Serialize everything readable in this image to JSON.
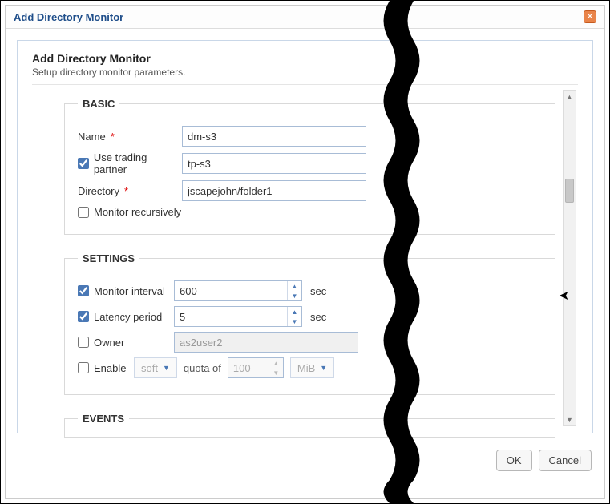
{
  "dialog": {
    "title": "Add Directory Monitor",
    "panel_title": "Add Directory Monitor",
    "panel_subtitle": "Setup directory monitor parameters."
  },
  "basic": {
    "legend": "BASIC",
    "name_label": "Name",
    "name_value": "dm-s3",
    "use_tp_label": "Use trading partner",
    "use_tp_checked": true,
    "tp_value": "tp-s3",
    "directory_label": "Directory",
    "directory_value": "jscapejohn/folder1",
    "recursive_label": "Monitor recursively",
    "recursive_checked": false
  },
  "settings": {
    "legend": "SETTINGS",
    "interval_label": "Monitor interval",
    "interval_checked": true,
    "interval_value": "600",
    "interval_unit": "sec",
    "latency_label": "Latency period",
    "latency_checked": true,
    "latency_value": "5",
    "latency_unit": "sec",
    "owner_label": "Owner",
    "owner_checked": false,
    "owner_value": "as2user2",
    "enable_label": "Enable",
    "enable_checked": false,
    "quota_type": "soft",
    "quota_mid": "quota of",
    "quota_value": "100",
    "quota_unit": "MiB"
  },
  "events": {
    "legend": "EVENTS"
  },
  "footer": {
    "ok": "OK",
    "cancel": "Cancel"
  }
}
